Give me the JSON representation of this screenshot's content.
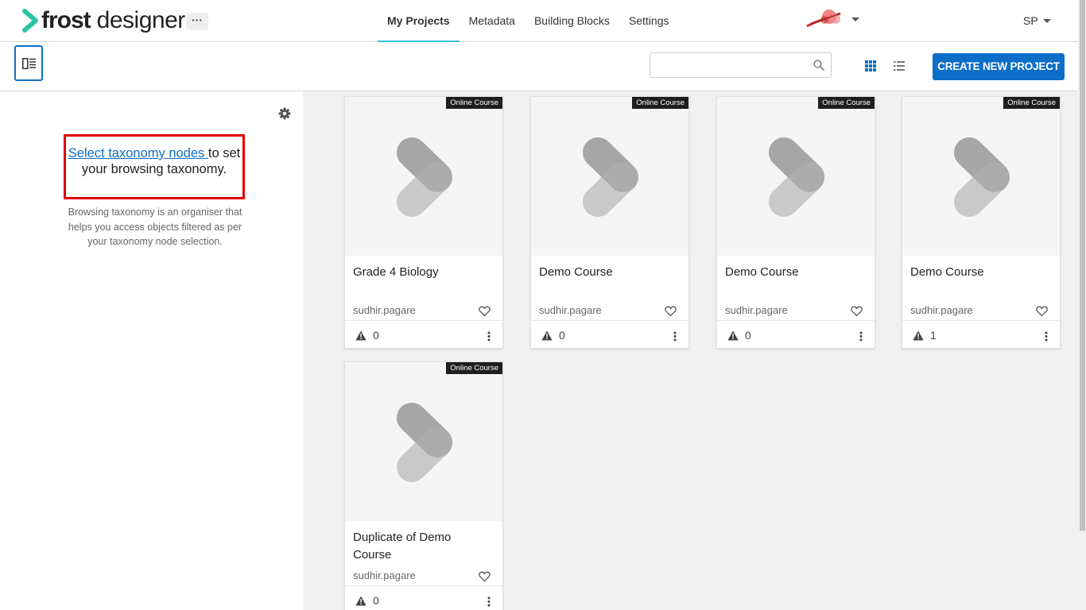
{
  "app": {
    "logo_bold": "frost",
    "logo_light": "designer",
    "more_label": "···"
  },
  "nav": {
    "tabs": [
      {
        "label": "My Projects",
        "active": true
      },
      {
        "label": "Metadata",
        "active": false
      },
      {
        "label": "Building Blocks",
        "active": false
      },
      {
        "label": "Settings",
        "active": false
      }
    ],
    "user_initials": "SP"
  },
  "toolbar": {
    "search_placeholder": "",
    "search_value": "",
    "create_label": "CREATE NEW PROJECT",
    "accent": "#0d6ec7"
  },
  "sidebar": {
    "select_link": "Select taxonomy nodes ",
    "select_rest": "to set your browsing taxonomy.",
    "help_text": "Browsing taxonomy is an organiser that helps you access objects filtered as per your taxonomy node selection."
  },
  "projects": [
    {
      "badge": "Online Course",
      "title": "Grade 4 Biology",
      "owner": "sudhir.pagare",
      "warnings": "0"
    },
    {
      "badge": "Online Course",
      "title": "Demo Course",
      "owner": "sudhir.pagare",
      "warnings": "0"
    },
    {
      "badge": "Online Course",
      "title": "Demo Course",
      "owner": "sudhir.pagare",
      "warnings": "0"
    },
    {
      "badge": "Online Course",
      "title": "Demo Course",
      "owner": "sudhir.pagare",
      "warnings": "1"
    },
    {
      "badge": "Online Course",
      "title": "Duplicate of Demo Course",
      "owner": "sudhir.pagare",
      "warnings": "0"
    }
  ],
  "icons": {
    "logo_chevron": "chevron-right-icon",
    "search": "search-icon",
    "grid": "grid-view-icon",
    "list": "list-view-icon",
    "gear": "gear-icon",
    "heart": "heart-icon",
    "warning": "warning-icon",
    "kebab": "kebab-menu-icon"
  }
}
